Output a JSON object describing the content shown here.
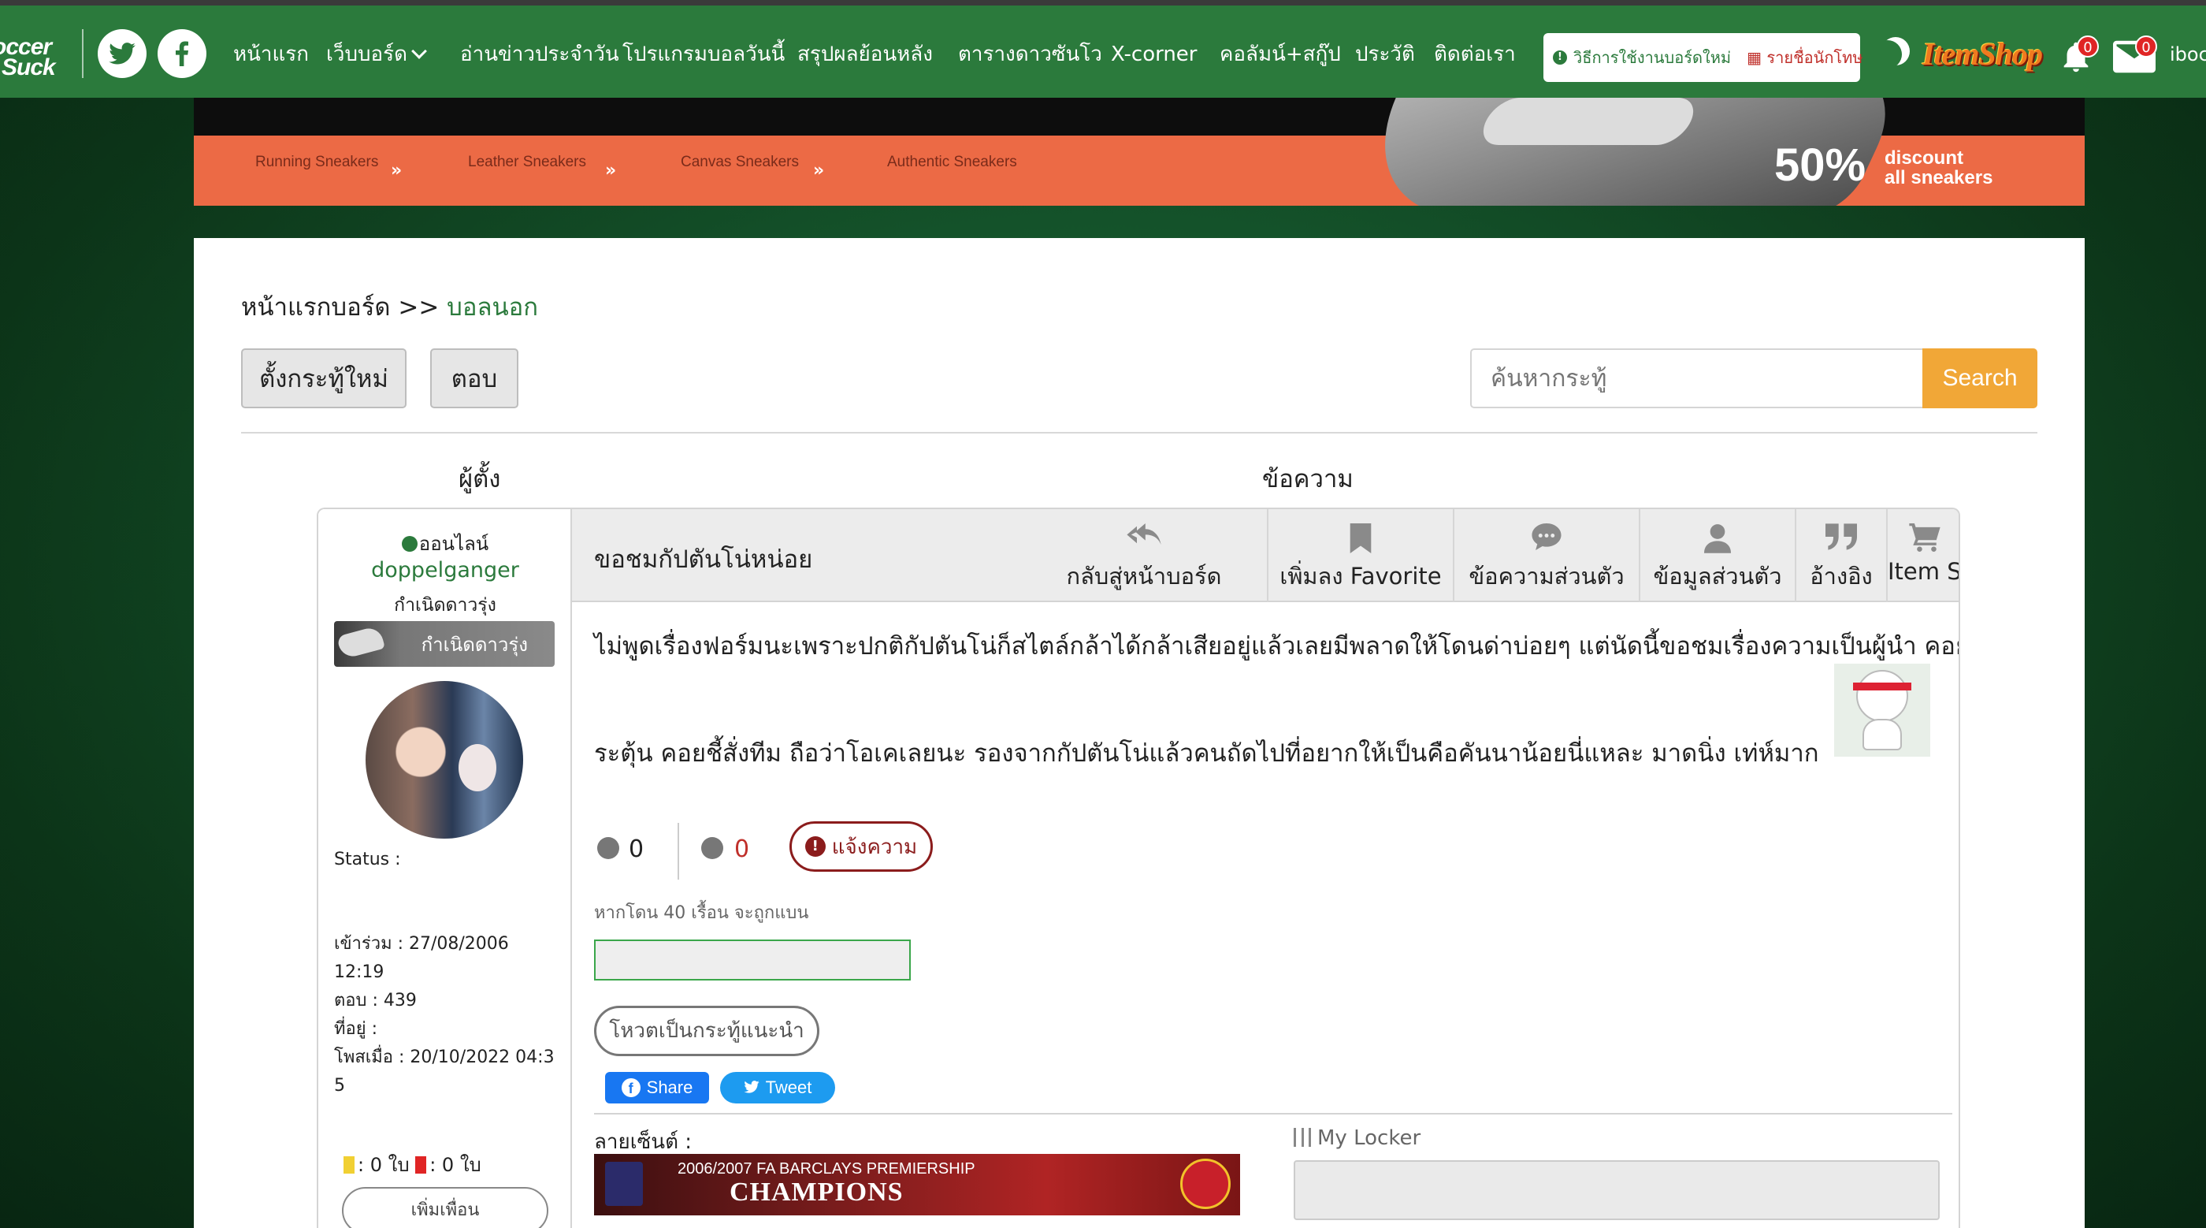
{
  "nav": {
    "logo_line1": "occer",
    "logo_line2": "Suck",
    "links": [
      "หน้าแรก",
      "เว็บบอร์ด",
      "อ่านข่าวประจำวัน",
      "โปรแกรมบอลวันนี้",
      "สรุปผลย้อนหลัง",
      "ตารางดาวซันโว",
      "X-corner",
      "คอลัมน์+สกู๊ป",
      "ประวัติ",
      "ติดต่อเรา"
    ],
    "guide_label": "วิธีการใช้งานบอร์ดใหม่",
    "blacklist_label": "รายชื่อนักโทษ",
    "itemshop_logo": "ItemShop",
    "notif_count": "0",
    "mail_count": "0",
    "user_partial": "iboc"
  },
  "ad": {
    "categories": [
      "Running Sneakers",
      "Leather Sneakers",
      "Canvas Sneakers",
      "Authentic Sneakers"
    ],
    "separator": "»",
    "percent": "50%",
    "discount_line1": "discount",
    "discount_line2": "all sneakers"
  },
  "breadcrumb": {
    "root": "หน้าแรกบอร์ด >> ",
    "current": "บอลนอก"
  },
  "buttons": {
    "new_topic": "ตั้งกระทู้ใหม่",
    "reply": "ตอบ"
  },
  "search": {
    "placeholder": "ค้นหากระทู้",
    "button": "Search"
  },
  "columns": {
    "author": "ผู้ตั้ง",
    "message": "ข้อความ"
  },
  "author": {
    "online": "ออนไลน์",
    "username": "doppelganger",
    "rank": "กำเนิดดาวรุ่ง",
    "rank_badge": "กำเนิดดาวรุ่ง",
    "status_label": "Status :",
    "joined": "เข้าร่วม : 27/08/2006 12:19",
    "replies": "ตอบ : 439",
    "location": "ที่อยู่ :",
    "last_post_1": "โพสเมื่อ : 20/10/2022 04:3",
    "last_post_2": "5",
    "cards_yellow": ": 0 ใบ",
    "cards_red": ": 0 ใบ",
    "add_friend": "เพิ่มเพื่อน"
  },
  "post": {
    "topic": "ขอชมกัปตันโน่หน่อย",
    "tools": [
      "กลับสู่หน้าบอร์ด",
      "เพิ่มลง Favorite",
      "ข้อความส่วนตัว",
      "ข้อมูลส่วนตัว",
      "อ้างอิง",
      "Item Shop"
    ],
    "body_line1": "ไม่พูดเรื่องฟอร์มนะเพราะปกติกัปตันโน่ก็สไตล์กล้าได้กล้าเสียอยู่แล้วเลยมีพลาดให้โดนด่าบ่อยๆ แต่นัดนี้ขอชมเรื่องความเป็นผู้นำ คอยก",
    "body_line2": "ระตุ้น คอยชี้สั่งทีม ถือว่าโอเคเลยนะ รองจากกัปตันโน่แล้วคนถัดไปที่อยากให้เป็นคือคันนาน้อยนี่แหละ มาดนิ่ง เท่ห์มาก",
    "likes": "0",
    "dislikes": "0",
    "report": "แจ้งความ",
    "ban_note": "หากโดน 40 เรื้อน จะถูกแบน",
    "vote": "โหวตเป็นกระทู้แนะนำ",
    "share": "Share",
    "tweet": "Tweet",
    "signature_label": "ลายเซ็นต์ :",
    "signature_line1": "2006/2007 FA BARCLAYS PREMIERSHIP",
    "signature_line2": "CHAMPIONS",
    "locker_label": "My Locker"
  },
  "colors": {
    "nav_green": "#2b7a3c",
    "search_orange": "#f1a737",
    "report_red": "#8b1c1c",
    "ad_orange": "#ec6a45"
  }
}
